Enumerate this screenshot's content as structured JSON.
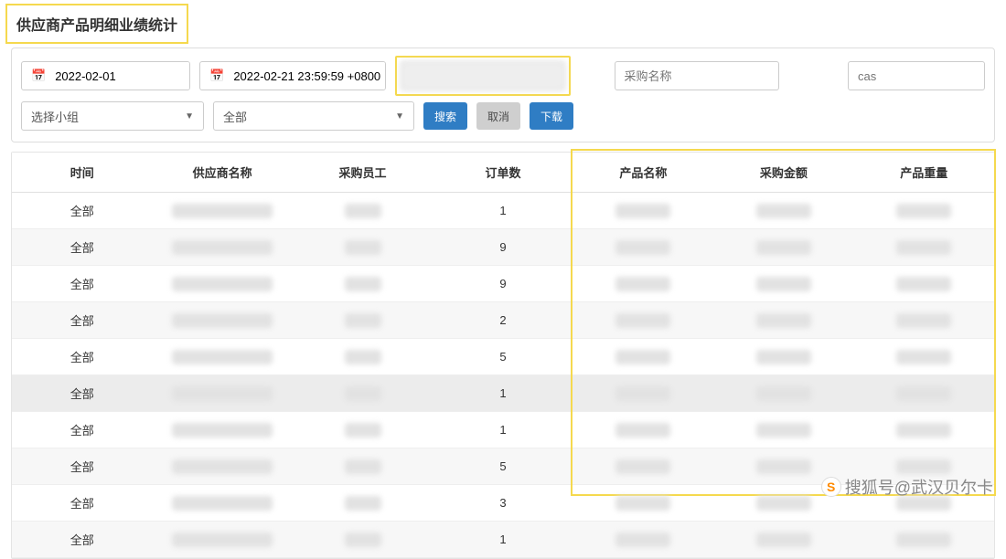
{
  "page": {
    "title": "供应商产品明细业绩统计"
  },
  "filters": {
    "start_date": "2022-02-01",
    "end_date": "2022-02-21 23:59:59 +0800",
    "search_placeholder": "",
    "purchase_name_placeholder": "采购名称",
    "cas_placeholder": "cas",
    "group_select_label": "选择小组",
    "all_select_label": "全部"
  },
  "buttons": {
    "search": "搜索",
    "cancel": "取消",
    "download": "下载"
  },
  "table": {
    "headers": {
      "time": "时间",
      "supplier": "供应商名称",
      "staff": "采购员工",
      "orders": "订单数",
      "product": "产品名称",
      "amount": "采购金额",
      "weight": "产品重量"
    },
    "rows": [
      {
        "time": "全部",
        "orders": "1"
      },
      {
        "time": "全部",
        "orders": "9"
      },
      {
        "time": "全部",
        "orders": "9"
      },
      {
        "time": "全部",
        "orders": "2"
      },
      {
        "time": "全部",
        "orders": "5"
      },
      {
        "time": "全部",
        "orders": "1",
        "shade": true
      },
      {
        "time": "全部",
        "orders": "1"
      },
      {
        "time": "全部",
        "orders": "5"
      },
      {
        "time": "全部",
        "orders": "3"
      },
      {
        "time": "全部",
        "orders": "1"
      }
    ]
  },
  "watermark": {
    "text": "搜狐号@武汉贝尔卡"
  }
}
